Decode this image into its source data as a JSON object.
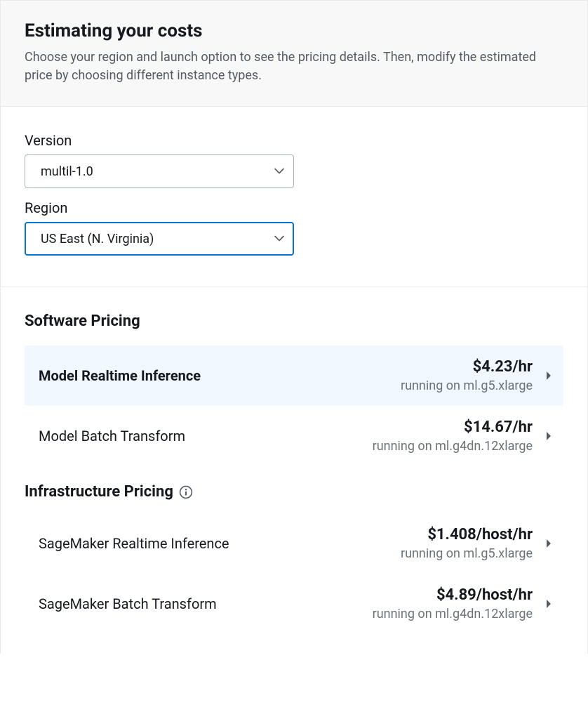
{
  "header": {
    "title": "Estimating your costs",
    "subtitle": "Choose your region and launch option to see the pricing details. Then, modify the estimated price by choosing different instance types."
  },
  "form": {
    "version": {
      "label": "Version",
      "selected": "multil-1.0"
    },
    "region": {
      "label": "Region",
      "selected": "US East (N. Virginia)"
    }
  },
  "software_pricing": {
    "heading": "Software Pricing",
    "rows": [
      {
        "name": "Model Realtime Inference",
        "price": "$4.23/hr",
        "subtext": "running on ml.g5.xlarge"
      },
      {
        "name": "Model Batch Transform",
        "price": "$14.67/hr",
        "subtext": "running on ml.g4dn.12xlarge"
      }
    ]
  },
  "infrastructure_pricing": {
    "heading": "Infrastructure Pricing",
    "rows": [
      {
        "name": "SageMaker Realtime Inference",
        "price": "$1.408/host/hr",
        "subtext": "running on ml.g5.xlarge"
      },
      {
        "name": "SageMaker Batch Transform",
        "price": "$4.89/host/hr",
        "subtext": "running on ml.g4dn.12xlarge"
      }
    ]
  }
}
